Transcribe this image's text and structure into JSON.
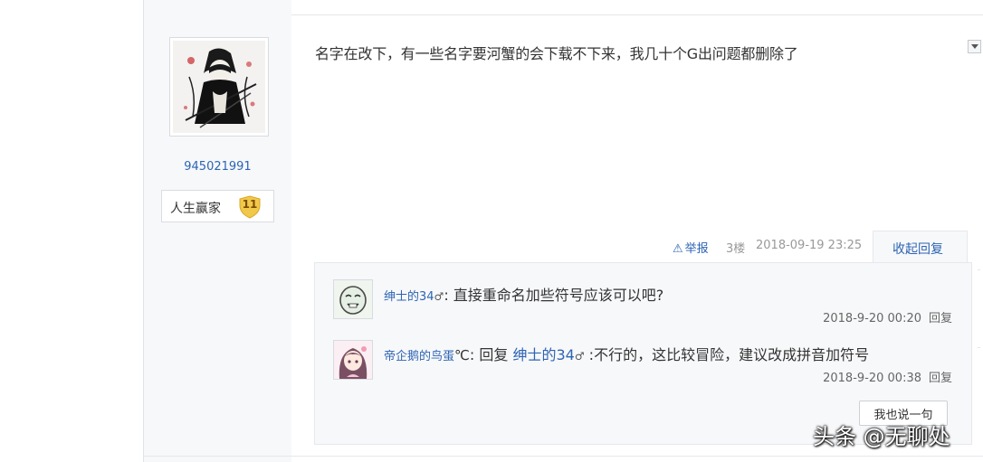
{
  "post": {
    "username": "945021991",
    "badge": {
      "label": "人生赢家",
      "level": "11"
    },
    "content": "名字在改下，有一些名字要河蟹的会下载不下来，我几十个G出问题都删除了",
    "meta": {
      "report_label": "举报",
      "floor": "3楼",
      "timestamp": "2018-09-19 23:25",
      "collapse_label": "收起回复"
    }
  },
  "replies": [
    {
      "user": "绅士的34",
      "gender_icon": "♂",
      "text": ": 直接重命名加些符号应该可以吧?",
      "time": "2018-9-20 00:20",
      "reply_label": "回复"
    },
    {
      "user": "帝企鹅的鸟蛋",
      "user_suffix": "℃",
      "prefix": ": 回复 ",
      "at_user": "绅士的34",
      "gender_icon": "♂",
      "text": " :不行的，这比较冒险，建议改成拼音加符号",
      "time": "2018-9-20 00:38",
      "reply_label": "回复"
    }
  ],
  "say_button_label": "我也说一句",
  "watermark": "头条 @无聊处",
  "colors": {
    "link": "#2d64b3",
    "panel": "#f7f8fa",
    "badge_gold": "#f2c84b"
  }
}
